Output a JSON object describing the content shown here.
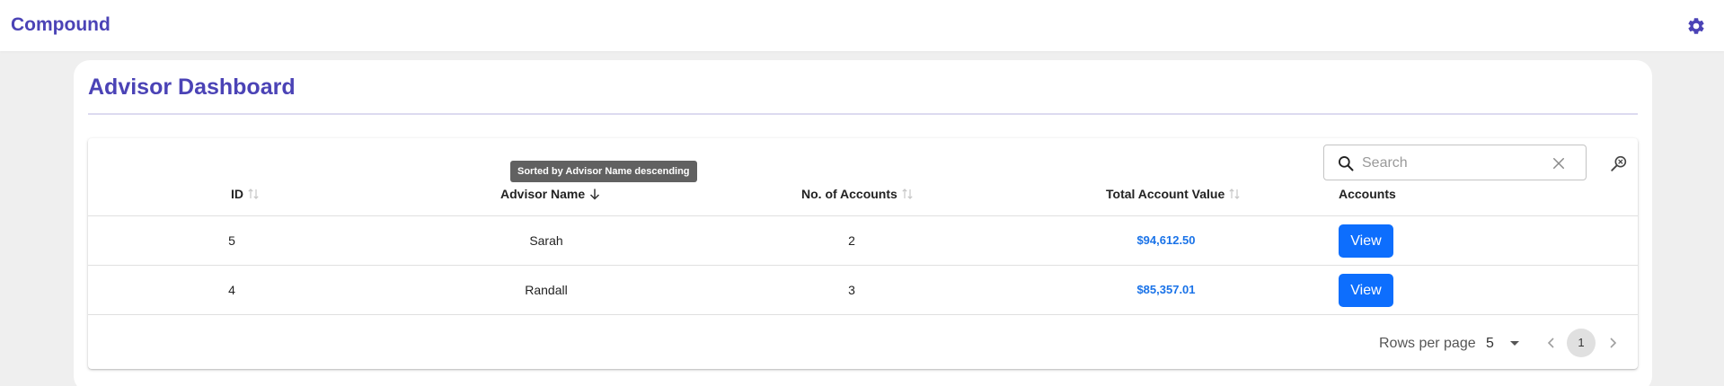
{
  "app": {
    "brand": "Compound",
    "settings_icon": "gear-icon"
  },
  "page": {
    "title": "Advisor Dashboard"
  },
  "search": {
    "placeholder": "Search",
    "value": ""
  },
  "tooltip": "Sorted by Advisor Name descending",
  "table": {
    "columns": [
      {
        "key": "id",
        "label": "ID",
        "sortable": true,
        "sort": "none"
      },
      {
        "key": "advisor_name",
        "label": "Advisor Name",
        "sortable": true,
        "sort": "descending"
      },
      {
        "key": "num_accounts",
        "label": "No. of Accounts",
        "sortable": true,
        "sort": "none"
      },
      {
        "key": "total_value",
        "label": "Total Account Value",
        "sortable": true,
        "sort": "none"
      },
      {
        "key": "accounts",
        "label": "Accounts",
        "sortable": false
      }
    ],
    "rows": [
      {
        "id": "5",
        "advisor_name": "Sarah",
        "num_accounts": "2",
        "total_value": "$94,612.50",
        "action": "View"
      },
      {
        "id": "4",
        "advisor_name": "Randall",
        "num_accounts": "3",
        "total_value": "$85,357.01",
        "action": "View"
      }
    ]
  },
  "pagination": {
    "rows_per_page_label": "Rows per page",
    "rows_per_page": "5",
    "current_page": "1"
  },
  "colors": {
    "brand": "#4b43b6",
    "link": "#1a73e8",
    "button": "#0d6efd"
  }
}
